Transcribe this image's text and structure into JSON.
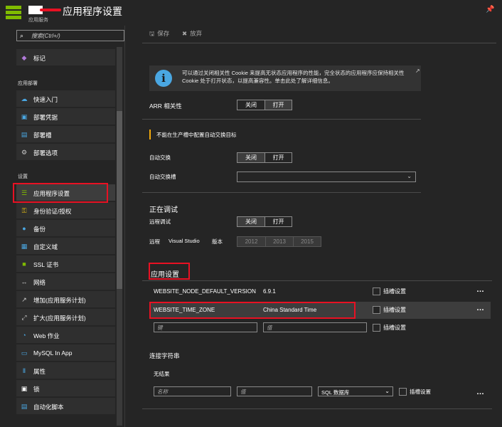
{
  "header": {
    "title": "应用程序设置",
    "subtitle": "应用服务",
    "pin_icon": "pin-icon"
  },
  "search": {
    "placeholder": "搜索(Ctrl+/)"
  },
  "sidebar": {
    "top_item": {
      "label": "标记",
      "icon": "tag-icon"
    },
    "section_deploy": "应用部署",
    "deploy_items": [
      {
        "label": "快速入门",
        "icon": "quickstart-icon"
      },
      {
        "label": "部署凭据",
        "icon": "credentials-icon"
      },
      {
        "label": "部署槽",
        "icon": "slots-icon"
      },
      {
        "label": "部署选项",
        "icon": "deploy-options-icon"
      }
    ],
    "section_settings": "设置",
    "settings_items": [
      {
        "label": "应用程序设置",
        "icon": "app-settings-icon"
      },
      {
        "label": "身份验证/授权",
        "icon": "key-icon"
      },
      {
        "label": "备份",
        "icon": "backup-icon"
      },
      {
        "label": "自定义域",
        "icon": "custom-domain-icon"
      },
      {
        "label": "SSL 证书",
        "icon": "ssl-icon"
      },
      {
        "label": "网络",
        "icon": "network-icon"
      },
      {
        "label": "增加(应用服务计划)",
        "icon": "scale-up-icon"
      },
      {
        "label": "扩大(应用服务计划)",
        "icon": "scale-out-icon"
      },
      {
        "label": "Web 作业",
        "icon": "webjobs-icon"
      },
      {
        "label": "MySQL In App",
        "icon": "mysql-icon"
      },
      {
        "label": "属性",
        "icon": "properties-icon"
      },
      {
        "label": "锁",
        "icon": "lock-icon"
      },
      {
        "label": "自动化脚本",
        "icon": "automation-icon"
      }
    ]
  },
  "toolbar": {
    "save_label": "保存",
    "discard_label": "放弃"
  },
  "info": {
    "text": "可以通过关闭相关性 Cookie 来提高无状态应用程序的性能，完全状态的应用程序应保持相关性 Cookie 处于打开状态，以提高兼容性。单击此处了解详细信息。"
  },
  "arr": {
    "label": "ARR 相关性",
    "off": "关闭",
    "on": "打开",
    "selected": "on"
  },
  "warning": {
    "text": "不能在生产槽中配置自动交换目标"
  },
  "auto_swap": {
    "label": "自动交换",
    "off": "关闭",
    "on": "打开",
    "selected": "off",
    "slot_label": "自动交换槽",
    "slot_value": ""
  },
  "debugging": {
    "heading": "正在调试",
    "remote_label": "远程调试",
    "off": "关闭",
    "on": "打开",
    "selected": "off",
    "vs_label_1": "远程",
    "vs_label_2": "Visual Studio",
    "vs_label_3": "版本",
    "vs_versions": [
      "2012",
      "2013",
      "2015"
    ]
  },
  "app_settings": {
    "heading": "应用设置",
    "slot_setting_label": "插槽设置",
    "rows": [
      {
        "key": "WEBSITE_NODE_DEFAULT_VERSION",
        "value": "6.9.1"
      },
      {
        "key": "WEBSITE_TIME_ZONE",
        "value": "China Standard Time"
      }
    ],
    "key_placeholder": "键",
    "value_placeholder": "值"
  },
  "connection_strings": {
    "heading": "连接字符串",
    "empty_text": "无结果",
    "name_placeholder": "名称",
    "value_placeholder": "值",
    "type_value": "SQL 数据库",
    "slot_setting_label": "插槽设置"
  },
  "colors": {
    "background": "#252525",
    "accent_green": "#7fba00",
    "info_blue": "#4aa7e2",
    "warning_orange": "#f2a90b",
    "highlight_red": "#e81123"
  }
}
